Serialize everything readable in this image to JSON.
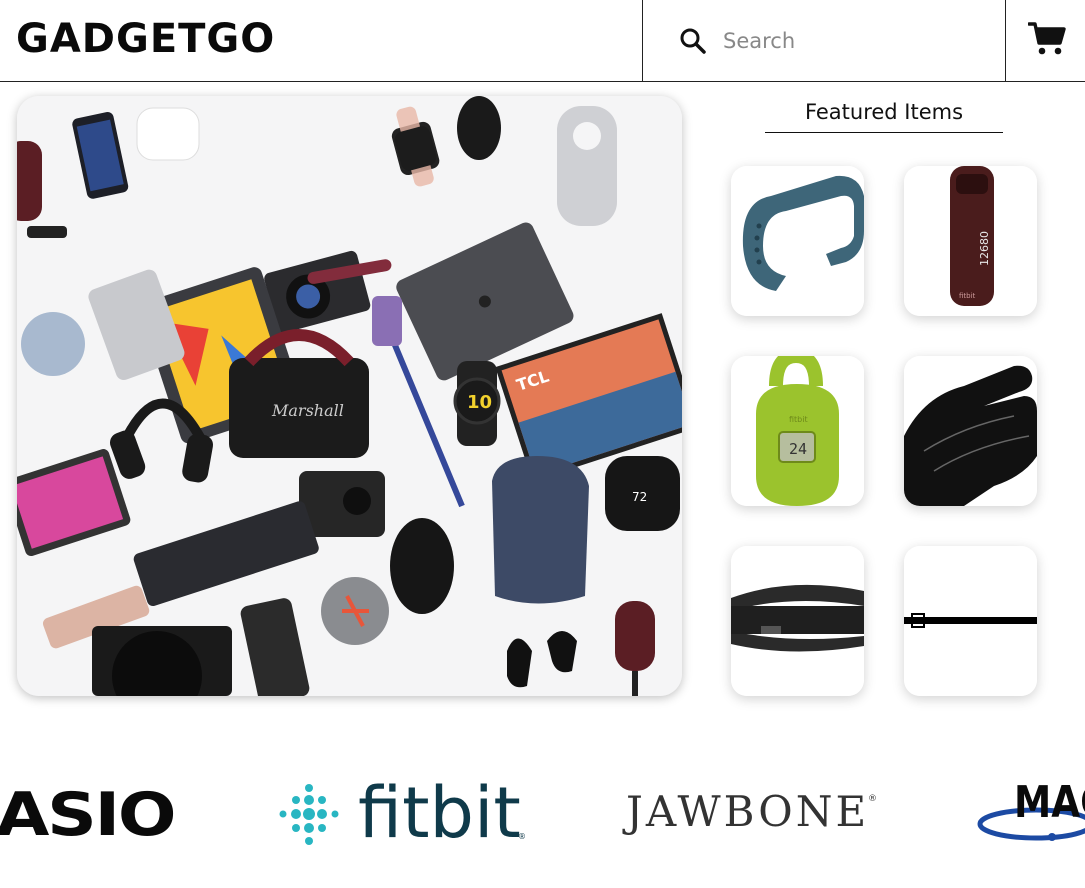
{
  "header": {
    "logo": "GADGETGO",
    "search": {
      "placeholder": "Search",
      "value": "",
      "icon": "search-icon"
    },
    "cart": {
      "icon": "shopping-cart-icon"
    }
  },
  "hero": {
    "image": "assorted-gadgets-flatlay"
  },
  "featured": {
    "title": "Featured Items",
    "items": [
      {
        "name": "blue-fitness-band",
        "color": "#3e6679"
      },
      {
        "name": "maroon-fitbit-one",
        "label": "12680",
        "brand": "fitbit",
        "color": "#4a1c1c"
      },
      {
        "name": "lime-fitbit-zip",
        "label": "24",
        "brand": "fitbit",
        "color": "#9bc32d"
      },
      {
        "name": "black-sensor-glove",
        "color": "#111111"
      },
      {
        "name": "chest-strap-heart-monitor",
        "color": "#222222"
      },
      {
        "name": "thin-black-strap",
        "color": "#000000"
      }
    ]
  },
  "brands": {
    "casio": "ASIO",
    "fitbit": "fitbit",
    "fitbit_reg": "®",
    "jawbone": "JAWBONE",
    "jawbone_reg": "®",
    "magellan": "MAG",
    "colors": {
      "fitbit_dots": "#28b6c2",
      "fitbit_text": "#0f3a4a",
      "magellan_swoosh": "#1c4aa3"
    }
  }
}
